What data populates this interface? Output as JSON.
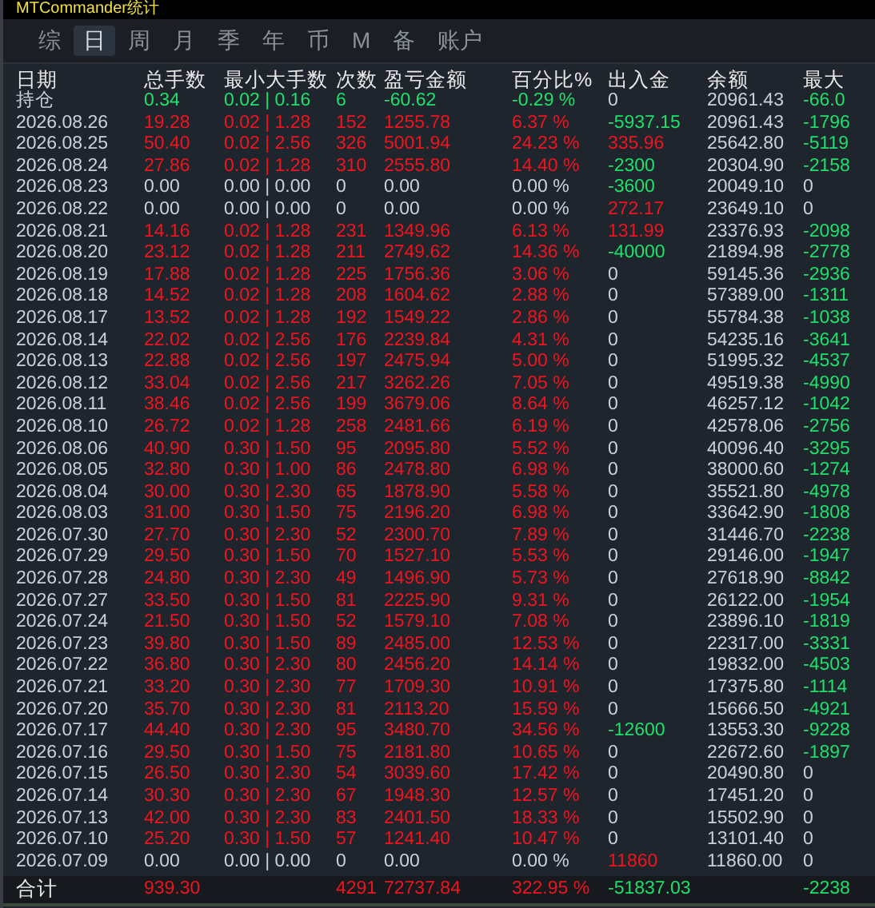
{
  "window": {
    "title": "MTCommander统计"
  },
  "tabs": [
    {
      "label": "综",
      "selected": false
    },
    {
      "label": "日",
      "selected": true
    },
    {
      "label": "周",
      "selected": false
    },
    {
      "label": "月",
      "selected": false
    },
    {
      "label": "季",
      "selected": false
    },
    {
      "label": "年",
      "selected": false
    },
    {
      "label": "币",
      "selected": false
    },
    {
      "label": "M",
      "selected": false
    },
    {
      "label": "备",
      "selected": false
    },
    {
      "label": "账户",
      "selected": false
    }
  ],
  "table": {
    "columns": [
      "日期",
      "总手数",
      "最小大手数",
      "次数",
      "盈亏金额",
      "百分比%",
      "出入金",
      "余额",
      "最大"
    ],
    "rows": [
      {
        "date": "持仓",
        "color": "#1ee06a",
        "lots": "0.34",
        "min_max": "0.02 | 0.16",
        "count": "6",
        "pnl": "-60.62",
        "pct": "-0.29 %",
        "inout": {
          "text": "0",
          "color": "#c8d0dc"
        },
        "balance": "20961.43",
        "max_drawdown": {
          "text": "-66.0",
          "color": "#1ee06a"
        }
      },
      {
        "date": "2026.08.26",
        "color": "#f0141e",
        "lots": "19.28",
        "min_max": "0.02 | 1.28",
        "count": "152",
        "pnl": "1255.78",
        "pct": "6.37 %",
        "inout": {
          "text": "-5937.15",
          "color": "#1ee06a"
        },
        "balance": "20961.43",
        "max_drawdown": {
          "text": "-1796",
          "color": "#1ee06a"
        }
      },
      {
        "date": "2026.08.25",
        "color": "#f0141e",
        "lots": "50.40",
        "min_max": "0.02 | 2.56",
        "count": "326",
        "pnl": "5001.94",
        "pct": "24.23 %",
        "inout": {
          "text": "335.96",
          "color": "#f0141e"
        },
        "balance": "25642.80",
        "max_drawdown": {
          "text": "-5119",
          "color": "#1ee06a"
        }
      },
      {
        "date": "2026.08.24",
        "color": "#f0141e",
        "lots": "27.86",
        "min_max": "0.02 | 1.28",
        "count": "310",
        "pnl": "2555.80",
        "pct": "14.40 %",
        "inout": {
          "text": "-2300",
          "color": "#1ee06a"
        },
        "balance": "20304.90",
        "max_drawdown": {
          "text": "-2158",
          "color": "#1ee06a"
        }
      },
      {
        "date": "2026.08.23",
        "color": "#c8d0dc",
        "lots": "0.00",
        "min_max": "0.00 | 0.00",
        "count": "0",
        "pnl": "0.00",
        "pct": "0.00 %",
        "inout": {
          "text": "-3600",
          "color": "#1ee06a"
        },
        "balance": "20049.10",
        "max_drawdown": {
          "text": "0",
          "color": "#c8d0dc"
        }
      },
      {
        "date": "2026.08.22",
        "color": "#c8d0dc",
        "lots": "0.00",
        "min_max": "0.00 | 0.00",
        "count": "0",
        "pnl": "0.00",
        "pct": "0.00 %",
        "inout": {
          "text": "272.17",
          "color": "#f0141e"
        },
        "balance": "23649.10",
        "max_drawdown": {
          "text": "0",
          "color": "#c8d0dc"
        }
      },
      {
        "date": "2026.08.21",
        "color": "#f0141e",
        "lots": "14.16",
        "min_max": "0.02 | 1.28",
        "count": "231",
        "pnl": "1349.96",
        "pct": "6.13 %",
        "inout": {
          "text": "131.99",
          "color": "#f0141e"
        },
        "balance": "23376.93",
        "max_drawdown": {
          "text": "-2098",
          "color": "#1ee06a"
        }
      },
      {
        "date": "2026.08.20",
        "color": "#f0141e",
        "lots": "23.12",
        "min_max": "0.02 | 1.28",
        "count": "211",
        "pnl": "2749.62",
        "pct": "14.36 %",
        "inout": {
          "text": "-40000",
          "color": "#1ee06a"
        },
        "balance": "21894.98",
        "max_drawdown": {
          "text": "-2778",
          "color": "#1ee06a"
        }
      },
      {
        "date": "2026.08.19",
        "color": "#f0141e",
        "lots": "17.88",
        "min_max": "0.02 | 1.28",
        "count": "225",
        "pnl": "1756.36",
        "pct": "3.06 %",
        "inout": {
          "text": "0",
          "color": "#c8d0dc"
        },
        "balance": "59145.36",
        "max_drawdown": {
          "text": "-2936",
          "color": "#1ee06a"
        }
      },
      {
        "date": "2026.08.18",
        "color": "#f0141e",
        "lots": "14.52",
        "min_max": "0.02 | 1.28",
        "count": "208",
        "pnl": "1604.62",
        "pct": "2.88 %",
        "inout": {
          "text": "0",
          "color": "#c8d0dc"
        },
        "balance": "57389.00",
        "max_drawdown": {
          "text": "-1311",
          "color": "#1ee06a"
        }
      },
      {
        "date": "2026.08.17",
        "color": "#f0141e",
        "lots": "13.52",
        "min_max": "0.02 | 1.28",
        "count": "192",
        "pnl": "1549.22",
        "pct": "2.86 %",
        "inout": {
          "text": "0",
          "color": "#c8d0dc"
        },
        "balance": "55784.38",
        "max_drawdown": {
          "text": "-1038",
          "color": "#1ee06a"
        }
      },
      {
        "date": "2026.08.14",
        "color": "#f0141e",
        "lots": "22.02",
        "min_max": "0.02 | 2.56",
        "count": "176",
        "pnl": "2239.84",
        "pct": "4.31 %",
        "inout": {
          "text": "0",
          "color": "#c8d0dc"
        },
        "balance": "54235.16",
        "max_drawdown": {
          "text": "-3641",
          "color": "#1ee06a"
        }
      },
      {
        "date": "2026.08.13",
        "color": "#f0141e",
        "lots": "22.88",
        "min_max": "0.02 | 2.56",
        "count": "197",
        "pnl": "2475.94",
        "pct": "5.00 %",
        "inout": {
          "text": "0",
          "color": "#c8d0dc"
        },
        "balance": "51995.32",
        "max_drawdown": {
          "text": "-4537",
          "color": "#1ee06a"
        }
      },
      {
        "date": "2026.08.12",
        "color": "#f0141e",
        "lots": "33.04",
        "min_max": "0.02 | 2.56",
        "count": "217",
        "pnl": "3262.26",
        "pct": "7.05 %",
        "inout": {
          "text": "0",
          "color": "#c8d0dc"
        },
        "balance": "49519.38",
        "max_drawdown": {
          "text": "-4990",
          "color": "#1ee06a"
        }
      },
      {
        "date": "2026.08.11",
        "color": "#f0141e",
        "lots": "38.46",
        "min_max": "0.02 | 2.56",
        "count": "199",
        "pnl": "3679.06",
        "pct": "8.64 %",
        "inout": {
          "text": "0",
          "color": "#c8d0dc"
        },
        "balance": "46257.12",
        "max_drawdown": {
          "text": "-1042",
          "color": "#1ee06a"
        }
      },
      {
        "date": "2026.08.10",
        "color": "#f0141e",
        "lots": "26.72",
        "min_max": "0.02 | 1.28",
        "count": "258",
        "pnl": "2481.66",
        "pct": "6.19 %",
        "inout": {
          "text": "0",
          "color": "#c8d0dc"
        },
        "balance": "42578.06",
        "max_drawdown": {
          "text": "-2756",
          "color": "#1ee06a"
        }
      },
      {
        "date": "2026.08.06",
        "color": "#f0141e",
        "lots": "40.90",
        "min_max": "0.30 | 1.50",
        "count": "95",
        "pnl": "2095.80",
        "pct": "5.52 %",
        "inout": {
          "text": "0",
          "color": "#c8d0dc"
        },
        "balance": "40096.40",
        "max_drawdown": {
          "text": "-3295",
          "color": "#1ee06a"
        }
      },
      {
        "date": "2026.08.05",
        "color": "#f0141e",
        "lots": "32.80",
        "min_max": "0.30 | 1.00",
        "count": "86",
        "pnl": "2478.80",
        "pct": "6.98 %",
        "inout": {
          "text": "0",
          "color": "#c8d0dc"
        },
        "balance": "38000.60",
        "max_drawdown": {
          "text": "-1274",
          "color": "#1ee06a"
        }
      },
      {
        "date": "2026.08.04",
        "color": "#f0141e",
        "lots": "30.00",
        "min_max": "0.30 | 2.30",
        "count": "65",
        "pnl": "1878.90",
        "pct": "5.58 %",
        "inout": {
          "text": "0",
          "color": "#c8d0dc"
        },
        "balance": "35521.80",
        "max_drawdown": {
          "text": "-4978",
          "color": "#1ee06a"
        }
      },
      {
        "date": "2026.08.03",
        "color": "#f0141e",
        "lots": "31.00",
        "min_max": "0.30 | 1.50",
        "count": "75",
        "pnl": "2196.20",
        "pct": "6.98 %",
        "inout": {
          "text": "0",
          "color": "#c8d0dc"
        },
        "balance": "33642.90",
        "max_drawdown": {
          "text": "-1808",
          "color": "#1ee06a"
        }
      },
      {
        "date": "2026.07.30",
        "color": "#f0141e",
        "lots": "27.70",
        "min_max": "0.30 | 2.30",
        "count": "52",
        "pnl": "2300.70",
        "pct": "7.89 %",
        "inout": {
          "text": "0",
          "color": "#c8d0dc"
        },
        "balance": "31446.70",
        "max_drawdown": {
          "text": "-2238",
          "color": "#1ee06a"
        }
      },
      {
        "date": "2026.07.29",
        "color": "#f0141e",
        "lots": "29.50",
        "min_max": "0.30 | 1.50",
        "count": "70",
        "pnl": "1527.10",
        "pct": "5.53 %",
        "inout": {
          "text": "0",
          "color": "#c8d0dc"
        },
        "balance": "29146.00",
        "max_drawdown": {
          "text": "-1947",
          "color": "#1ee06a"
        }
      },
      {
        "date": "2026.07.28",
        "color": "#f0141e",
        "lots": "24.80",
        "min_max": "0.30 | 2.30",
        "count": "49",
        "pnl": "1496.90",
        "pct": "5.73 %",
        "inout": {
          "text": "0",
          "color": "#c8d0dc"
        },
        "balance": "27618.90",
        "max_drawdown": {
          "text": "-8842",
          "color": "#1ee06a"
        }
      },
      {
        "date": "2026.07.27",
        "color": "#f0141e",
        "lots": "33.50",
        "min_max": "0.30 | 1.50",
        "count": "81",
        "pnl": "2225.90",
        "pct": "9.31 %",
        "inout": {
          "text": "0",
          "color": "#c8d0dc"
        },
        "balance": "26122.00",
        "max_drawdown": {
          "text": "-1954",
          "color": "#1ee06a"
        }
      },
      {
        "date": "2026.07.24",
        "color": "#f0141e",
        "lots": "21.50",
        "min_max": "0.30 | 1.50",
        "count": "52",
        "pnl": "1579.10",
        "pct": "7.08 %",
        "inout": {
          "text": "0",
          "color": "#c8d0dc"
        },
        "balance": "23896.10",
        "max_drawdown": {
          "text": "-1819",
          "color": "#1ee06a"
        }
      },
      {
        "date": "2026.07.23",
        "color": "#f0141e",
        "lots": "39.80",
        "min_max": "0.30 | 1.50",
        "count": "89",
        "pnl": "2485.00",
        "pct": "12.53 %",
        "inout": {
          "text": "0",
          "color": "#c8d0dc"
        },
        "balance": "22317.00",
        "max_drawdown": {
          "text": "-3331",
          "color": "#1ee06a"
        }
      },
      {
        "date": "2026.07.22",
        "color": "#f0141e",
        "lots": "36.80",
        "min_max": "0.30 | 2.30",
        "count": "80",
        "pnl": "2456.20",
        "pct": "14.14 %",
        "inout": {
          "text": "0",
          "color": "#c8d0dc"
        },
        "balance": "19832.00",
        "max_drawdown": {
          "text": "-4503",
          "color": "#1ee06a"
        }
      },
      {
        "date": "2026.07.21",
        "color": "#f0141e",
        "lots": "33.20",
        "min_max": "0.30 | 2.30",
        "count": "77",
        "pnl": "1709.30",
        "pct": "10.91 %",
        "inout": {
          "text": "0",
          "color": "#c8d0dc"
        },
        "balance": "17375.80",
        "max_drawdown": {
          "text": "-1114",
          "color": "#1ee06a"
        }
      },
      {
        "date": "2026.07.20",
        "color": "#f0141e",
        "lots": "35.70",
        "min_max": "0.30 | 2.30",
        "count": "81",
        "pnl": "2113.20",
        "pct": "15.59 %",
        "inout": {
          "text": "0",
          "color": "#c8d0dc"
        },
        "balance": "15666.50",
        "max_drawdown": {
          "text": "-4921",
          "color": "#1ee06a"
        }
      },
      {
        "date": "2026.07.17",
        "color": "#f0141e",
        "lots": "44.40",
        "min_max": "0.30 | 2.30",
        "count": "95",
        "pnl": "3480.70",
        "pct": "34.56 %",
        "inout": {
          "text": "-12600",
          "color": "#1ee06a"
        },
        "balance": "13553.30",
        "max_drawdown": {
          "text": "-9228",
          "color": "#1ee06a"
        }
      },
      {
        "date": "2026.07.16",
        "color": "#f0141e",
        "lots": "29.50",
        "min_max": "0.30 | 1.50",
        "count": "75",
        "pnl": "2181.80",
        "pct": "10.65 %",
        "inout": {
          "text": "0",
          "color": "#c8d0dc"
        },
        "balance": "22672.60",
        "max_drawdown": {
          "text": "-1897",
          "color": "#1ee06a"
        }
      },
      {
        "date": "2026.07.15",
        "color": "#f0141e",
        "lots": "26.50",
        "min_max": "0.30 | 2.30",
        "count": "54",
        "pnl": "3039.60",
        "pct": "17.42 %",
        "inout": {
          "text": "0",
          "color": "#c8d0dc"
        },
        "balance": "20490.80",
        "max_drawdown": {
          "text": "0",
          "color": "#c8d0dc"
        }
      },
      {
        "date": "2026.07.14",
        "color": "#f0141e",
        "lots": "30.30",
        "min_max": "0.30 | 2.30",
        "count": "67",
        "pnl": "1948.30",
        "pct": "12.57 %",
        "inout": {
          "text": "0",
          "color": "#c8d0dc"
        },
        "balance": "17451.20",
        "max_drawdown": {
          "text": "0",
          "color": "#c8d0dc"
        }
      },
      {
        "date": "2026.07.13",
        "color": "#f0141e",
        "lots": "42.00",
        "min_max": "0.30 | 2.30",
        "count": "83",
        "pnl": "2401.50",
        "pct": "18.33 %",
        "inout": {
          "text": "0",
          "color": "#c8d0dc"
        },
        "balance": "15502.90",
        "max_drawdown": {
          "text": "0",
          "color": "#c8d0dc"
        }
      },
      {
        "date": "2026.07.10",
        "color": "#f0141e",
        "lots": "25.20",
        "min_max": "0.30 | 1.50",
        "count": "57",
        "pnl": "1241.40",
        "pct": "10.47 %",
        "inout": {
          "text": "0",
          "color": "#c8d0dc"
        },
        "balance": "13101.40",
        "max_drawdown": {
          "text": "0",
          "color": "#c8d0dc"
        }
      },
      {
        "date": "2026.07.09",
        "color": "#c8d0dc",
        "lots": "0.00",
        "min_max": "0.00 | 0.00",
        "count": "0",
        "pnl": "0.00",
        "pct": "0.00 %",
        "inout": {
          "text": "11860",
          "color": "#f0141e"
        },
        "balance": "11860.00",
        "max_drawdown": {
          "text": "0",
          "color": "#c8d0dc"
        }
      }
    ],
    "total": {
      "label": "合计",
      "color": "#f0141e",
      "lots": "939.30",
      "count": "4291",
      "pnl": "72737.84",
      "pct": "322.95 %",
      "inout": {
        "text": "-51837.03",
        "color": "#1ee06a"
      },
      "max_drawdown": {
        "text": "-2238",
        "color": "#1ee06a"
      }
    }
  }
}
